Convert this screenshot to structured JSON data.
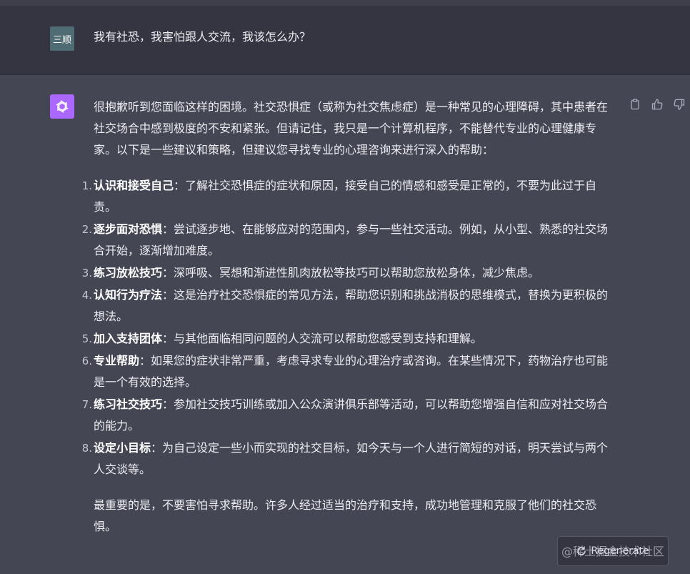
{
  "user_message": {
    "avatar_text": "三顺",
    "text": "我有社恐，我害怕跟人交流，我该怎么办？"
  },
  "assistant_message": {
    "avatar_icon": "openai-logo-icon",
    "intro": "很抱歉听到您面临这样的困境。社交恐惧症（或称为社交焦虑症）是一种常见的心理障碍，其中患者在社交场合中感到极度的不安和紧张。但请记住，我只是一个计算机程序，不能替代专业的心理健康专家。以下是一些建议和策略，但建议您寻找专业的心理咨询来进行深入的帮助：",
    "tips": [
      {
        "num": "1.",
        "title": "认识和接受自己",
        "text": "：了解社交恐惧症的症状和原因，接受自己的情感和感受是正常的，不要为此过于自责。"
      },
      {
        "num": "2.",
        "title": "逐步面对恐惧",
        "text": "：尝试逐步地、在能够应对的范围内，参与一些社交活动。例如，从小型、熟悉的社交场合开始，逐渐增加难度。"
      },
      {
        "num": "3.",
        "title": "练习放松技巧",
        "text": "：深呼吸、冥想和渐进性肌肉放松等技巧可以帮助您放松身体，减少焦虑。"
      },
      {
        "num": "4.",
        "title": "认知行为疗法",
        "text": "：这是治疗社交恐惧症的常见方法，帮助您识别和挑战消极的思维模式，替换为更积极的想法。"
      },
      {
        "num": "5.",
        "title": "加入支持团体",
        "text": "：与其他面临相同问题的人交流可以帮助您感受到支持和理解。"
      },
      {
        "num": "6.",
        "title": "专业帮助",
        "text": "：如果您的症状非常严重，考虑寻求专业的心理治疗或咨询。在某些情况下，药物治疗也可能是一个有效的选择。"
      },
      {
        "num": "7.",
        "title": "练习社交技巧",
        "text": "：参加社交技巧训练或加入公众演讲俱乐部等活动，可以帮助您增强自信和应对社交场合的能力。"
      },
      {
        "num": "8.",
        "title": "设定小目标",
        "text": "：为自己设定一些小而实现的社交目标，如今天与一个人进行简短的对话，明天尝试与两个人交谈等。"
      }
    ],
    "conclusion": "最重要的是，不要害怕寻求帮助。许多人经过适当的治疗和支持，成功地管理和克服了他们的社交恐惧。"
  },
  "actions": {
    "copy_icon": "clipboard-icon",
    "like_icon": "thumbs-up-icon",
    "dislike_icon": "thumbs-down-icon"
  },
  "regenerate": {
    "label": "Regenerate",
    "icon": "refresh-icon"
  },
  "watermark": "@稀土掘金技术社区",
  "colors": {
    "page_bg": "#444654",
    "user_row_bg": "#343541",
    "bot_avatar_bg": "#ab68ff",
    "user_avatar_bg": "#4f6b73"
  }
}
